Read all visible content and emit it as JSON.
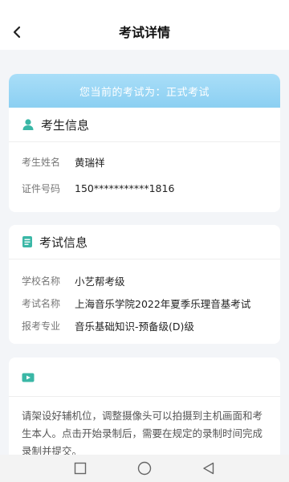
{
  "header": {
    "title": "考试详情"
  },
  "banner": {
    "text": "您当前的考试为：正式考试"
  },
  "candidate": {
    "title": "考生信息",
    "fields": [
      {
        "label": "考生姓名",
        "value": "黄瑞祥"
      },
      {
        "label": "证件号码",
        "value": "150***********1816"
      }
    ]
  },
  "exam": {
    "title": "考试信息",
    "fields": [
      {
        "label": "学校名称",
        "value": "小艺帮考级"
      },
      {
        "label": "考试名称",
        "value": "上海音乐学院2022年夏季乐理音基考试"
      },
      {
        "label": "报考专业",
        "value": "音乐基础知识-预备级(D)级"
      }
    ]
  },
  "notice": {
    "text": "请架设好辅机位，调整摄像头可以拍摄到主机画面和考生本人。点击开始录制后，需要在规定的录制时间完成录制并提交。"
  },
  "icons": {
    "back": "chevron-left-icon",
    "candidate": "person-icon",
    "exam": "document-icon",
    "video": "video-icon",
    "nav_recent": "square-icon",
    "nav_home": "circle-icon",
    "nav_back": "triangle-back-icon"
  },
  "colors": {
    "accent": "#3ab7a6",
    "banner": "#9fd8f6",
    "background": "#f3f5f8"
  }
}
